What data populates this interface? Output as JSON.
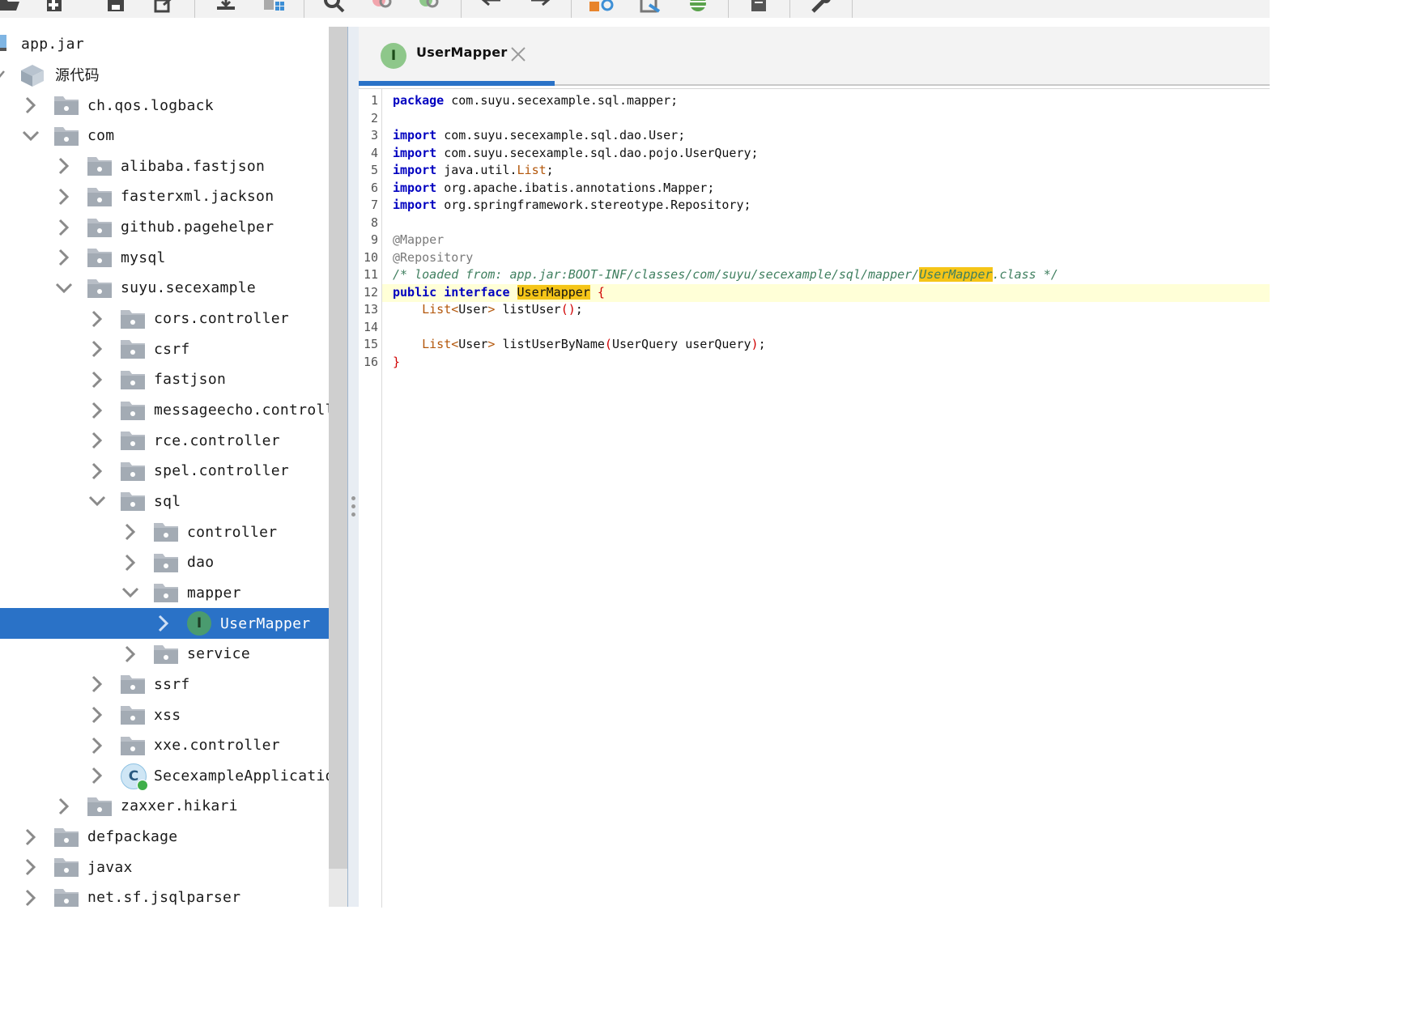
{
  "toolbar": {
    "icons": [
      "open-icon",
      "add-file-icon",
      "save-icon",
      "export-icon",
      "download-icon",
      "layout-icon",
      "search-icon",
      "find-usages-icon",
      "find-class-icon",
      "back-arrow-icon",
      "forward-arrow-icon",
      "lock-settings-icon",
      "decompile-icon",
      "debug-icon",
      "document-icon",
      "settings-wrench-icon"
    ]
  },
  "tree": {
    "root": "app.jar",
    "source_label": "源代码",
    "nodes": [
      {
        "label": "ch.qos.logback",
        "icon": "folder-icon"
      },
      {
        "label": "com",
        "icon": "folder-icon"
      },
      {
        "label": "alibaba.fastjson",
        "icon": "folder-icon"
      },
      {
        "label": "fasterxml.jackson",
        "icon": "folder-icon"
      },
      {
        "label": "github.pagehelper",
        "icon": "folder-icon"
      },
      {
        "label": "mysql",
        "icon": "folder-icon"
      },
      {
        "label": "suyu.secexample",
        "icon": "folder-icon"
      },
      {
        "label": "cors.controller",
        "icon": "folder-icon"
      },
      {
        "label": "csrf",
        "icon": "folder-icon"
      },
      {
        "label": "fastjson",
        "icon": "folder-icon"
      },
      {
        "label": "messageecho.controll",
        "icon": "folder-icon"
      },
      {
        "label": "rce.controller",
        "icon": "folder-icon"
      },
      {
        "label": "spel.controller",
        "icon": "folder-icon"
      },
      {
        "label": "sql",
        "icon": "folder-icon"
      },
      {
        "label": "controller",
        "icon": "folder-icon"
      },
      {
        "label": "dao",
        "icon": "folder-icon"
      },
      {
        "label": "mapper",
        "icon": "folder-icon"
      },
      {
        "label": "UserMapper",
        "icon": "interface-icon",
        "badge": "I"
      },
      {
        "label": "service",
        "icon": "folder-icon"
      },
      {
        "label": "ssrf",
        "icon": "folder-icon"
      },
      {
        "label": "xss",
        "icon": "folder-icon"
      },
      {
        "label": "xxe.controller",
        "icon": "folder-icon"
      },
      {
        "label": "SecexampleApplicatio",
        "icon": "class-icon",
        "badge": "C"
      },
      {
        "label": "zaxxer.hikari",
        "icon": "folder-icon"
      },
      {
        "label": "defpackage",
        "icon": "folder-icon"
      },
      {
        "label": "javax",
        "icon": "folder-icon"
      },
      {
        "label": "net.sf.jsqlparser",
        "icon": "folder-icon"
      }
    ]
  },
  "tab": {
    "badge": "I",
    "title": "UserMapper"
  },
  "editor": {
    "line_numbers": [
      "1",
      "2",
      "3",
      "4",
      "5",
      "6",
      "7",
      "8",
      "9",
      "10",
      "11",
      "12",
      "13",
      "14",
      "15",
      "16"
    ],
    "code": {
      "kw_package": "package",
      "pkg": " com.suyu.secexample.sql.mapper;",
      "kw_import": "import",
      "imp1": " com.suyu.secexample.sql.dao.User;",
      "imp2": " com.suyu.secexample.sql.dao.pojo.UserQuery;",
      "imp3a": " java.util.",
      "imp3_type": "List",
      "semi": ";",
      "imp4": " org.apache.ibatis.annotations.Mapper;",
      "imp5": " org.springframework.stereotype.Repository;",
      "ann1": "@Mapper",
      "ann2": "@Repository",
      "comment_a": "/* loaded from: app.jar:BOOT-INF/classes/com/suyu/secexample/sql/mapper/",
      "comment_mark": "UserMapper",
      "comment_b": ".class */",
      "kw_public": "public",
      "kw_interface": "interface",
      "iface_name": "UserMapper",
      "open_brace": "{",
      "indent": "    ",
      "type_list": "List",
      "lt": "<",
      "gt": ">",
      "type_user": "User",
      "m1": " listUser",
      "parens": "()",
      "m2": " listUserByName",
      "paren_open": "(",
      "param": "UserQuery userQuery",
      "paren_close": ")",
      "close_brace": "}"
    }
  }
}
